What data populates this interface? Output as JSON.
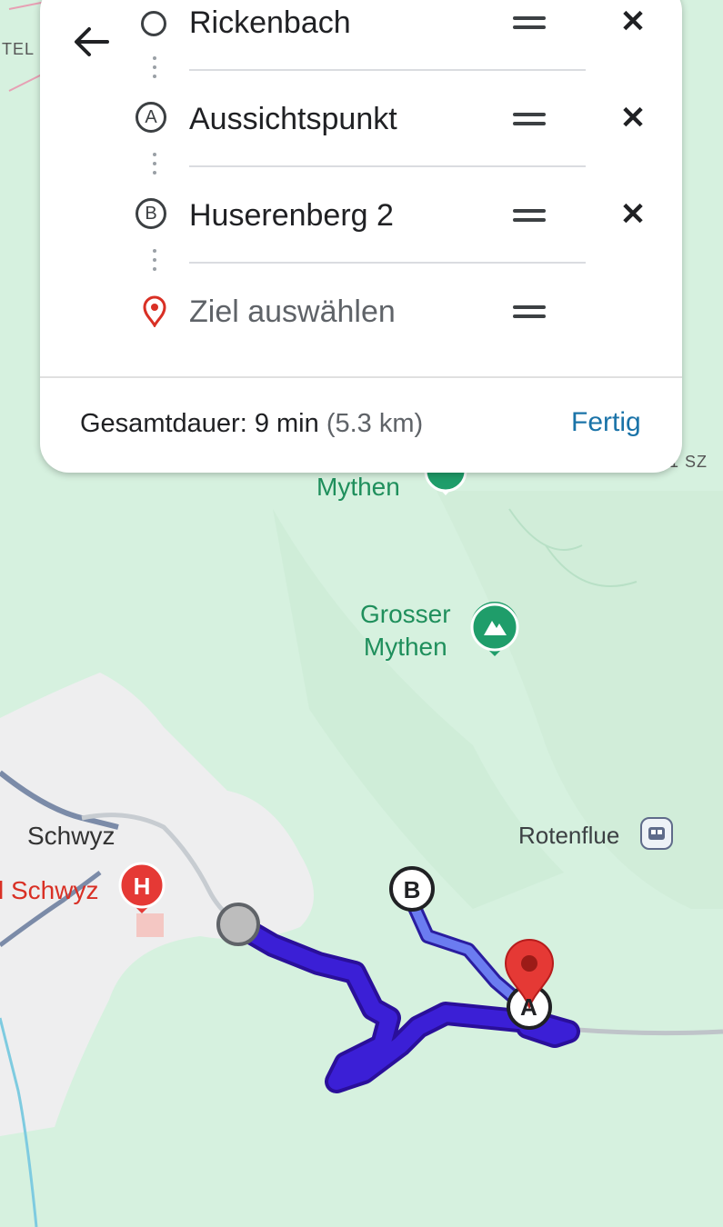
{
  "route_panel": {
    "back_icon": "arrow-left-icon",
    "stops": [
      {
        "marker": "○",
        "label": "Rickenbach",
        "icon": "circle-start-icon"
      },
      {
        "marker": "A",
        "label": "Aussichtspunkt",
        "icon": "waypoint-a-icon"
      },
      {
        "marker": "B",
        "label": "Huserenberg 2",
        "icon": "waypoint-b-icon"
      }
    ],
    "destination_placeholder": "Ziel auswählen",
    "remove_symbol": "✕",
    "total_label": "Gesamtdauer:",
    "total_time": "9 min",
    "total_distance": "(5.3 km)",
    "done_label": "Fertig"
  },
  "map": {
    "labels": {
      "mythen_partial": "Mythen",
      "grosser_mythen_line1": "Grosser",
      "grosser_mythen_line2": "Mythen",
      "schwyz": "Schwyz",
      "hospital": "l Schwyz",
      "rotenflue": "Rotenflue",
      "edge_top_left": "TEL",
      "edge_top_right": "1 SZ"
    },
    "markers": {
      "waypoint_b": "B",
      "waypoint_a": "A",
      "hospital_symbol": "H"
    },
    "colors": {
      "route": "#3b1fd6",
      "route_secondary": "#5a6cf0",
      "destination_pin": "#e53935",
      "peak_icon": "#1f9d6a",
      "hospital": "#e53935"
    }
  }
}
